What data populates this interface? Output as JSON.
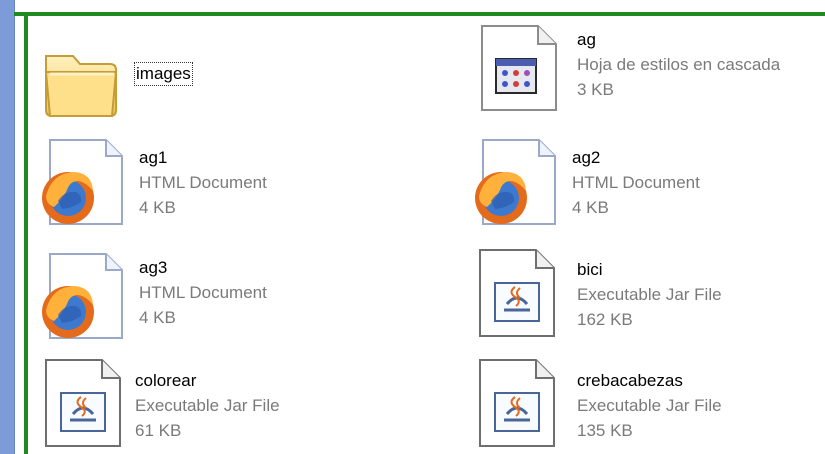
{
  "items": [
    {
      "name": "images",
      "icon": "folder-icon",
      "kind": "folder"
    },
    {
      "name": "ag",
      "type": "Hoja de estilos en cascada",
      "size": "3 KB",
      "icon": "css-file-icon"
    },
    {
      "name": "ag1",
      "type": "HTML Document",
      "size": "4 KB",
      "icon": "firefox-html-icon"
    },
    {
      "name": "ag2",
      "type": "HTML Document",
      "size": "4 KB",
      "icon": "firefox-html-icon"
    },
    {
      "name": "ag3",
      "type": "HTML Document",
      "size": "4 KB",
      "icon": "firefox-html-icon"
    },
    {
      "name": "bici",
      "type": "Executable Jar File",
      "size": "162 KB",
      "icon": "java-jar-icon"
    },
    {
      "name": "colorear",
      "type": "Executable Jar File",
      "size": "61 KB",
      "icon": "java-jar-icon"
    },
    {
      "name": "crebacabezas",
      "type": "Executable Jar File",
      "size": "135 KB",
      "icon": "java-jar-icon"
    }
  ],
  "colors": {
    "sidebar_blue": "#7e9bd9",
    "selection_green": "#1f8a1f",
    "secondary_text": "#7a7a7a"
  }
}
